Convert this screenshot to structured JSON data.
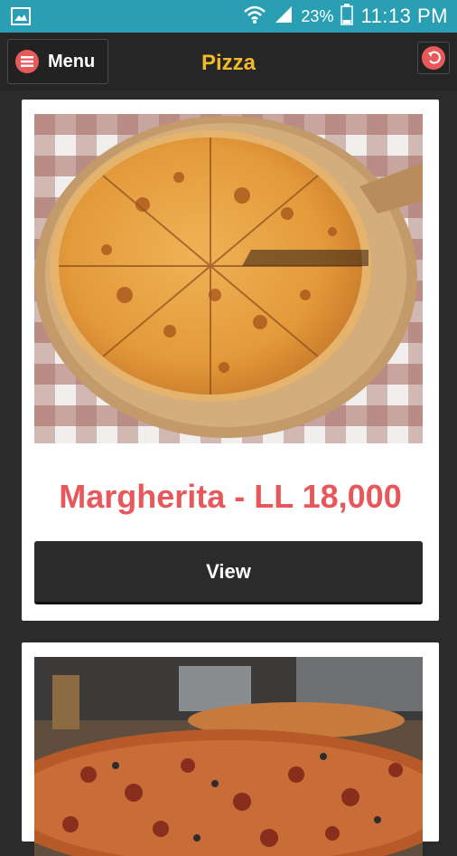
{
  "status_bar": {
    "battery": "23%",
    "time": "11:13 PM",
    "icons": [
      "gallery-icon",
      "wifi-icon",
      "signal-icon",
      "battery-icon"
    ]
  },
  "header": {
    "menu_label": "Menu",
    "title": "Pizza",
    "icons": [
      "hamburger-icon",
      "back-icon"
    ]
  },
  "items": [
    {
      "title": "Margherita - LL 18,000",
      "button": "View"
    },
    {
      "title": "",
      "button": ""
    }
  ],
  "colors": {
    "status_bar": "#2a9fb3",
    "title": "#f2b92c",
    "accent": "#e8575a",
    "background": "#2b2b2b"
  }
}
